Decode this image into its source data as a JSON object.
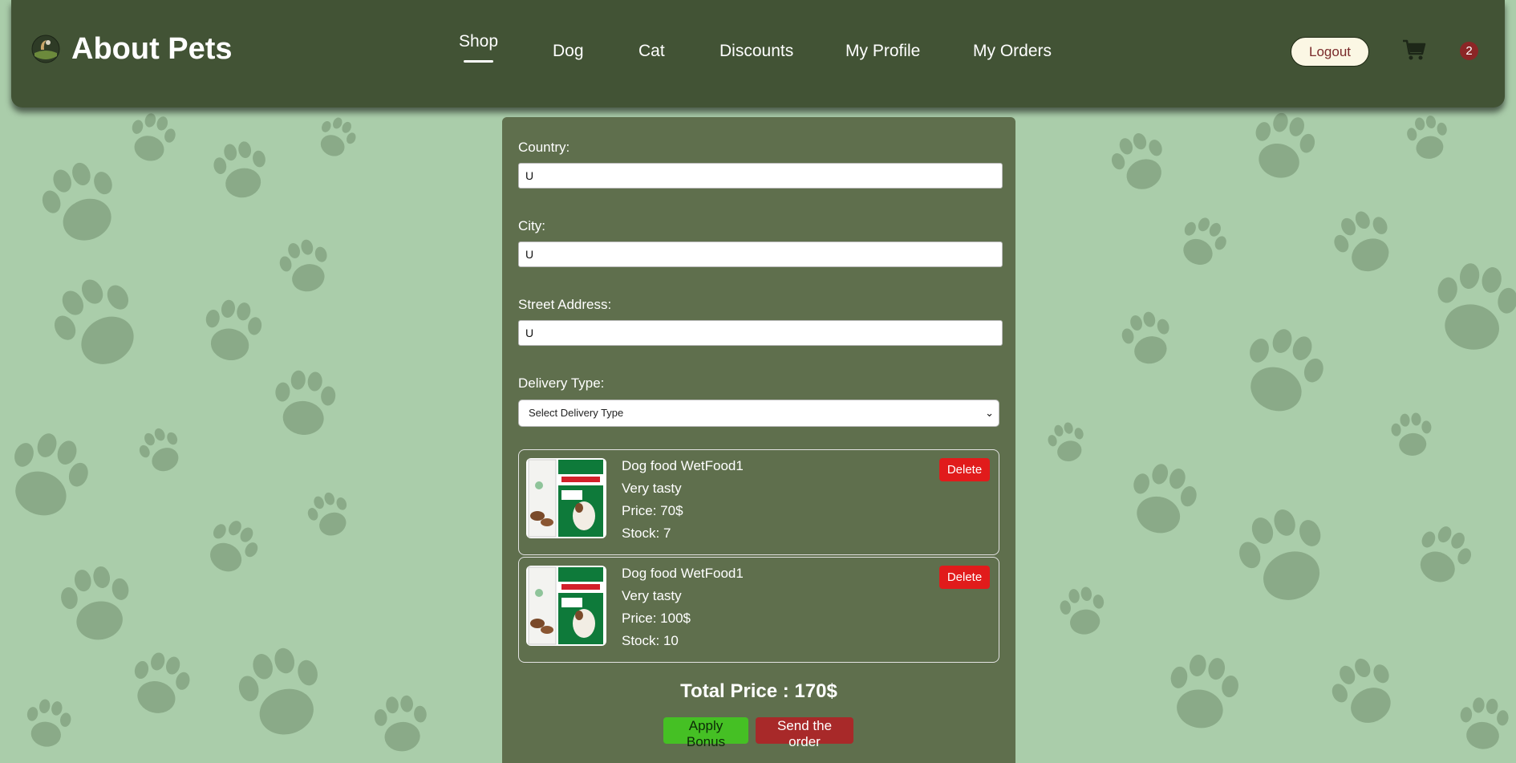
{
  "header": {
    "brand": "About Pets",
    "nav": [
      {
        "label": "Shop",
        "active": true
      },
      {
        "label": "Dog"
      },
      {
        "label": "Cat"
      },
      {
        "label": "Discounts"
      },
      {
        "label": "My Profile"
      },
      {
        "label": "My Orders"
      }
    ],
    "logout_label": "Logout",
    "cart_icon": "shopping-cart-icon",
    "cart_count": "2"
  },
  "form": {
    "country": {
      "label": "Country:",
      "value": "U"
    },
    "city": {
      "label": "City:",
      "value": "U"
    },
    "street": {
      "label": "Street Address:",
      "value": "U"
    },
    "delivery": {
      "label": "Delivery Type:",
      "selected": "Select Delivery Type"
    }
  },
  "cart": {
    "items": [
      {
        "name": "Dog food WetFood1",
        "description": "Very tasty",
        "price": "Price: 70$",
        "stock": "Stock: 7",
        "delete_label": "Delete"
      },
      {
        "name": "Dog food WetFood1",
        "description": "Very tasty",
        "price": "Price: 100$",
        "stock": "Stock: 10",
        "delete_label": "Delete"
      }
    ],
    "total": "Total Price : 170$",
    "apply_bonus_label": "Apply Bonus",
    "send_order_label": "Send the order"
  },
  "colors": {
    "background": "#aacdaa",
    "header": "#425335",
    "panel": "#5f6f4d",
    "delete": "#e11b1b",
    "apply": "#45c024",
    "send": "#a82929"
  }
}
